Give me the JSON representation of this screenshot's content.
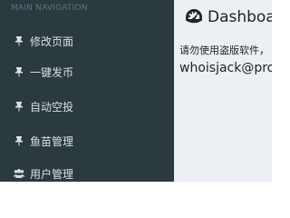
{
  "sidebar": {
    "header": "MAIN NAVIGATION",
    "items": [
      {
        "label": "修改页面",
        "icon": "pin-icon"
      },
      {
        "label": "一键发币",
        "icon": "pin-icon"
      },
      {
        "label": "自动空投",
        "icon": "pin-icon"
      },
      {
        "label": "鱼苗管理",
        "icon": "pin-icon"
      },
      {
        "label": "用户管理",
        "icon": "users-icon"
      }
    ]
  },
  "main": {
    "title": "Dashboard",
    "notice": "请勿使用盗版软件，",
    "email": "whoisjack@protonmail.com"
  },
  "colors": {
    "sidebar_bg": "#2b3a3f",
    "content_bg": "#ecf0f5",
    "sidebar_text": "#d7e0e3",
    "header_text": "#5a7480"
  }
}
